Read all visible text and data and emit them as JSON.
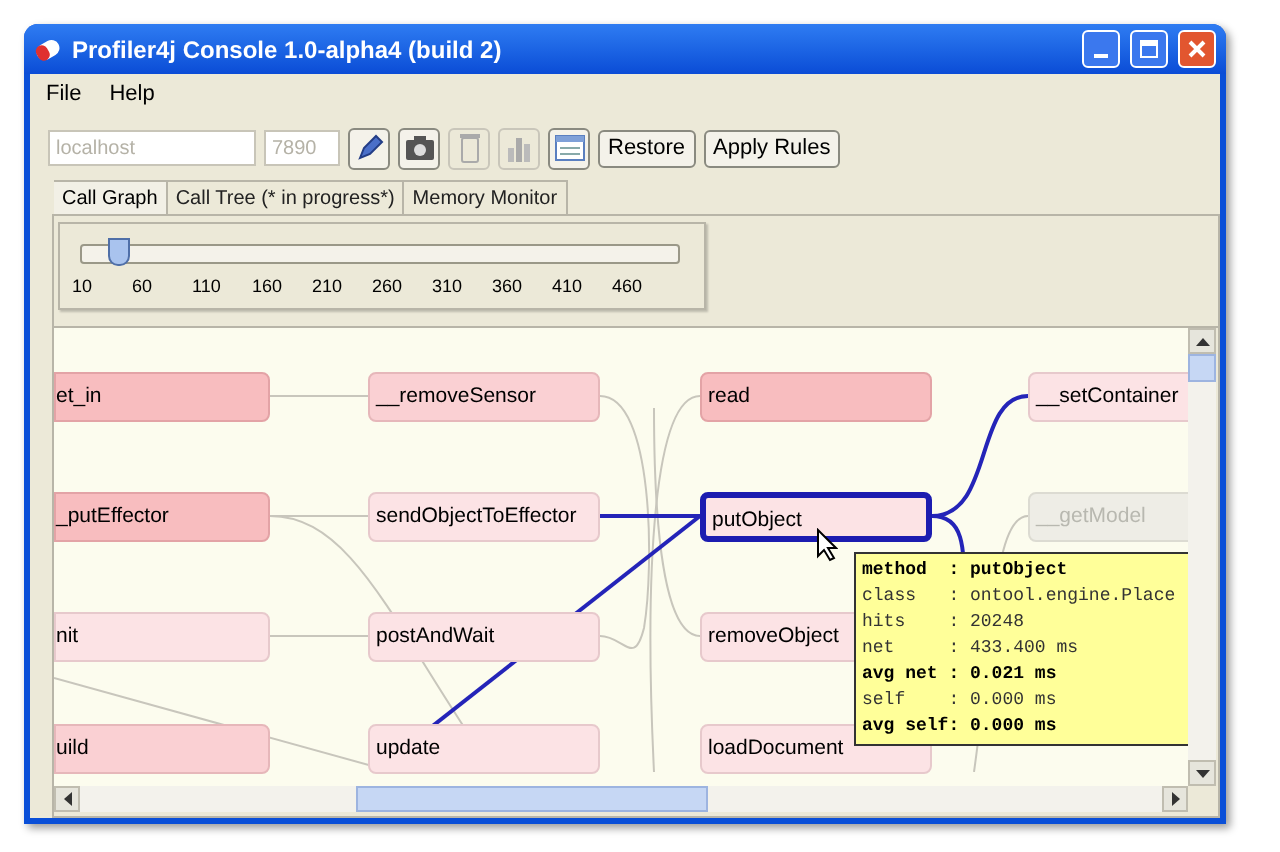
{
  "window": {
    "title": "Profiler4j Console 1.0-alpha4 (build 2)"
  },
  "menu": [
    "File",
    "Help"
  ],
  "toolbar": {
    "host": {
      "value": "localhost",
      "disabled": true
    },
    "port": {
      "value": "7890",
      "disabled": true
    },
    "icon_buttons": [
      {
        "kind": "connect",
        "disabled": false
      },
      {
        "kind": "snapshot",
        "disabled": false
      },
      {
        "kind": "gc",
        "disabled": true
      },
      {
        "kind": "stats",
        "disabled": true
      },
      {
        "kind": "rules",
        "disabled": false
      }
    ],
    "buttons": [
      "Restore",
      "Apply Rules"
    ]
  },
  "tabs": [
    {
      "label": "Call Graph",
      "selected": true
    },
    {
      "label": "Call Tree (* in progress*)",
      "selected": false
    },
    {
      "label": "Memory Monitor",
      "selected": false
    }
  ],
  "slider": {
    "level": 0.06,
    "ticks": [
      "10",
      "60",
      "110",
      "160",
      "210",
      "260",
      "310",
      "360",
      "410",
      "460"
    ]
  },
  "graph": {
    "columns": [
      {
        "nodes": [
          {
            "label": "et_in",
            "kind": "hot",
            "selected": false
          },
          {
            "label": "_putEffector",
            "kind": "hot",
            "selected": false
          },
          {
            "label": "nit",
            "kind": "cool",
            "selected": false
          },
          {
            "label": "uild",
            "kind": "warm",
            "selected": false
          }
        ]
      },
      {
        "nodes": [
          {
            "label": "__removeSensor",
            "kind": "warm",
            "selected": false
          },
          {
            "label": "sendObjectToEffector",
            "kind": "cool",
            "selected": false
          },
          {
            "label": "postAndWait",
            "kind": "cool",
            "selected": false
          },
          {
            "label": "update",
            "kind": "cool",
            "selected": false
          }
        ]
      },
      {
        "nodes": [
          {
            "label": "read",
            "kind": "hot",
            "selected": false
          },
          {
            "label": "putObject",
            "kind": "cool",
            "selected": true
          },
          {
            "label": "removeObject",
            "kind": "cool",
            "selected": false
          },
          {
            "label": "loadDocument",
            "kind": "cool",
            "selected": false
          }
        ]
      },
      {
        "nodes": [
          {
            "label": "__setContainer",
            "kind": "cool",
            "selected": false
          },
          {
            "label": "__getModel",
            "kind": "faded",
            "selected": false
          }
        ]
      }
    ],
    "tooltip": [
      {
        "text": "method  : putObject",
        "bold": true
      },
      {
        "text": "class   : ontool.engine.Place",
        "bold": false
      },
      {
        "text": "hits    : 20248",
        "bold": false
      },
      {
        "text": "net     : 433.400 ms",
        "bold": false
      },
      {
        "text": "avg net : 0.021 ms",
        "bold": true
      },
      {
        "text": "self    : 0.000 ms",
        "bold": false
      },
      {
        "text": "avg self: 0.000 ms",
        "bold": true
      }
    ]
  }
}
